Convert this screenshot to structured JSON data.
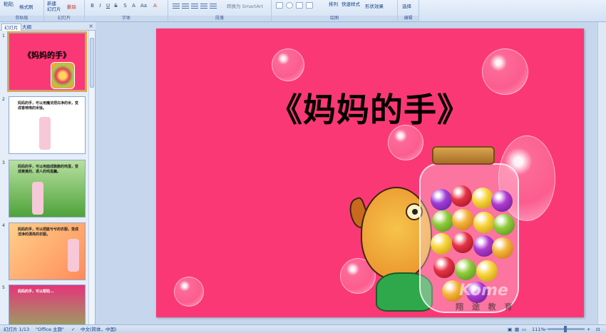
{
  "ribbon": {
    "clipboard": {
      "paste": "粘贴",
      "format_painter": "格式刷",
      "label": "剪贴板"
    },
    "slides": {
      "new_slide": "新建\n幻灯片",
      "delete": "删除",
      "label": "幻灯片"
    },
    "font": {
      "label": "字体"
    },
    "paragraph": {
      "label": "段落",
      "smartart": "转换为 SmartArt"
    },
    "drawing": {
      "arrange": "排列",
      "quick_styles": "快速样式",
      "shape_effects": "形状效果",
      "label": "绘图"
    },
    "editing": {
      "select": "选择",
      "label": "编辑"
    }
  },
  "panel": {
    "tab_slides": "幻灯片",
    "tab_outline": "大纲",
    "close": "×"
  },
  "thumbnails": [
    {
      "num": "1",
      "title": "《妈妈的手》",
      "bg": "#fb3876"
    },
    {
      "num": "2",
      "text": "妈妈的手，可以用魔法把白净的米，变成香喷喷的米饭。",
      "bg": "#ffffff"
    },
    {
      "num": "3",
      "text": "妈妈的手，可以用面成脆脆的鸡蛋，变成黄黄的、诱人的鸡蛋羹。",
      "bg": "#7fc55a"
    },
    {
      "num": "4",
      "text": "妈妈的手，可以把脏兮兮的衣服，变成洁净的漂亮的衣服。",
      "bg": "#ffb870"
    },
    {
      "num": "5",
      "text": "妈妈的手，可以帮助...",
      "bg": "#e6347a"
    }
  ],
  "slide": {
    "title": "《妈妈的手》",
    "watermark": "Kome",
    "watermark2": "翔  途  教  育"
  },
  "status": {
    "slide_pos": "幻灯片 1/13",
    "theme": "\"Office 主题\"",
    "language": "中文(简体，中国)",
    "zoom": "111%"
  },
  "colors": {
    "slide_bg": "#fb3876",
    "ribbon": "#d3e1f3",
    "accent": "#15428b"
  }
}
